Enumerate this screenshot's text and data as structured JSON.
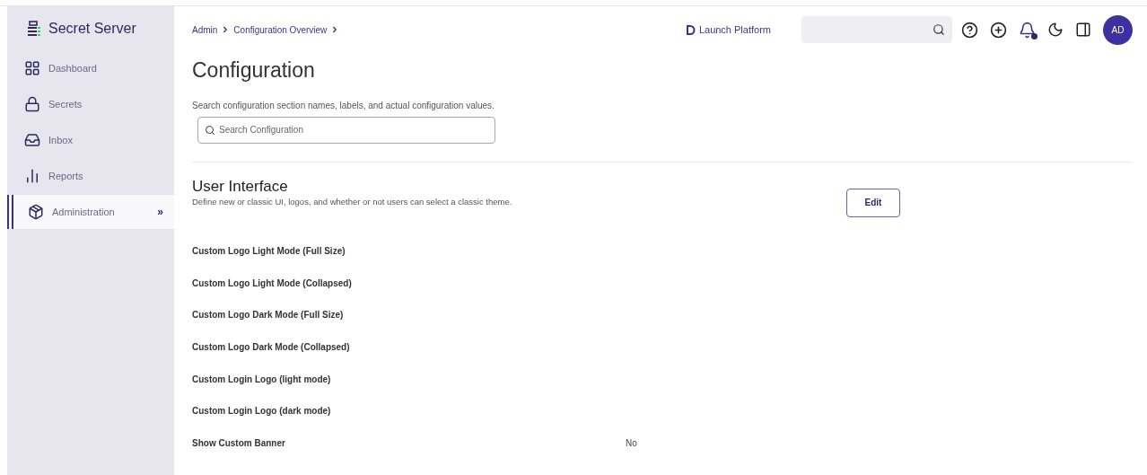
{
  "sidebar": {
    "brand": "Secret Server",
    "items": [
      {
        "kind": "dashboard",
        "label": "Dashboard",
        "selected": false
      },
      {
        "kind": "secrets",
        "label": "Secrets",
        "selected": false
      },
      {
        "kind": "inbox",
        "label": "Inbox",
        "selected": false
      },
      {
        "kind": "reports",
        "label": "Reports",
        "selected": false
      },
      {
        "kind": "administration",
        "label": "Administration",
        "selected": true,
        "expander": "»"
      }
    ]
  },
  "breadcrumb": [
    "Admin",
    "Configuration Overview"
  ],
  "header": {
    "launch": "Launch Platform",
    "avatar": "AD",
    "notification": true
  },
  "page": {
    "title": "Configuration",
    "search_hint": "Search configuration section names, labels, and actual configuration values.",
    "search": {
      "placeholder": "Search Configuration"
    }
  },
  "section": {
    "title": "User Interface",
    "description": "Define new or classic UI, logos, and whether or not users can select a classic theme.",
    "button": "Edit",
    "rows": [
      {
        "label": "Custom Logo Light Mode (Full Size)"
      },
      {
        "label": "Custom Logo Light Mode (Collapsed)"
      },
      {
        "label": "Custom Logo Dark Mode (Full Size)"
      },
      {
        "label": "Custom Logo Dark Mode (Collapsed)"
      },
      {
        "label": "Custom Login Logo (light mode)"
      },
      {
        "label": "Custom Login Logo (dark mode)"
      },
      {
        "label": "Show Custom Banner",
        "value": "No"
      }
    ]
  }
}
